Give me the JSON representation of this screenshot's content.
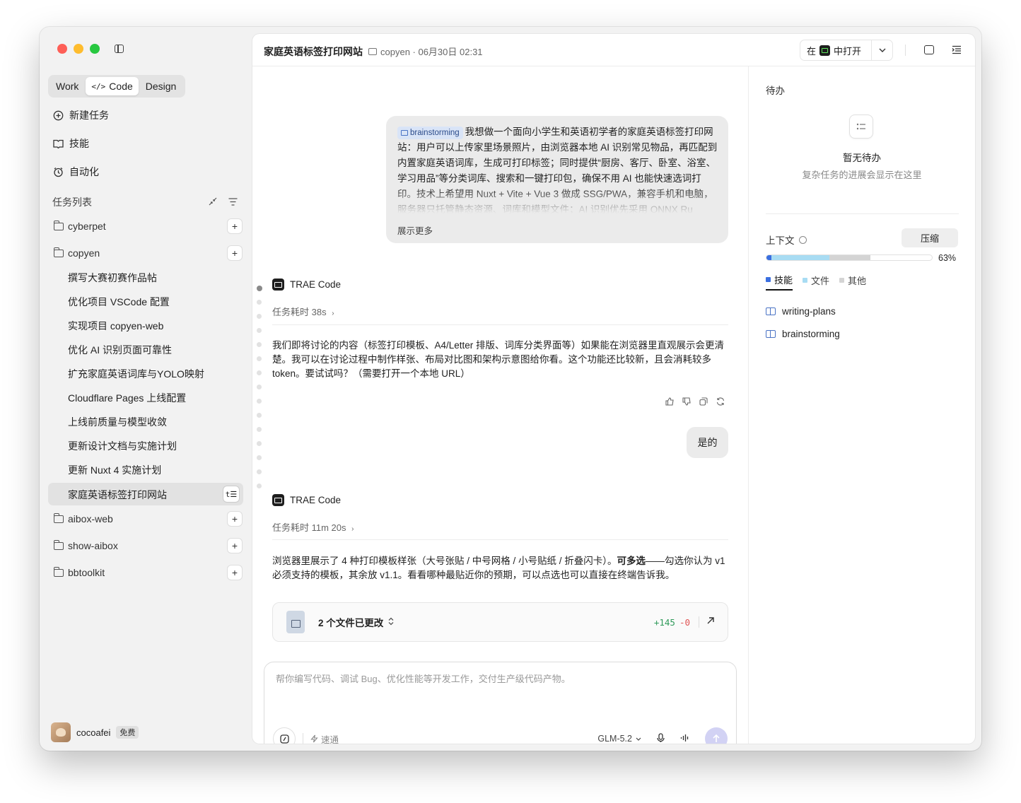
{
  "sidebar": {
    "modes": [
      "Work",
      "Code",
      "Design"
    ],
    "active_mode": "Code",
    "nav": [
      {
        "label": "新建任务",
        "icon": "new-task-icon"
      },
      {
        "label": "技能",
        "icon": "skills-icon"
      },
      {
        "label": "自动化",
        "icon": "alarm-clock-icon"
      }
    ],
    "section_title": "任务列表",
    "projects_top": [
      "cyberpet",
      "copyen"
    ],
    "tasks": [
      "撰写大赛初赛作品帖",
      "优化项目 VSCode 配置",
      "实现项目 copyen-web",
      "优化 AI 识别页面可靠性",
      "扩充家庭英语词库与YOLO映射",
      "Cloudflare Pages 上线配置",
      "上线前质量与模型收敛",
      "更新设计文档与实施计划",
      "更新 Nuxt 4 实施计划"
    ],
    "active_task": "家庭英语标签打印网站",
    "projects_bottom": [
      "aibox-web",
      "show-aibox",
      "bbtoolkit"
    ],
    "user": {
      "name": "cocoafei",
      "plan": "免费"
    }
  },
  "topbar": {
    "title": "家庭英语标签打印网站",
    "meta": "copyen · 06月30日 02:31",
    "open_in_prefix": "在",
    "open_in_suffix": "中打开"
  },
  "chat": {
    "user_message": {
      "skill_tag": "brainstorming",
      "text": "我想做一个面向小学生和英语初学者的家庭英语标签打印网站：用户可以上传家里场景照片，由浏览器本地 AI 识别常见物品，再匹配到内置家庭英语词库，生成可打印标签；同时提供“厨房、客厅、卧室、浴室、学习用品”等分类词库、搜索和一键打印包，确保不用 AI 也能快速选词打印。技术上希望用 Nuxt + Vite + Vue 3 做成 SSG/PWA，兼容手机和电脑，服务器只托管静态资源、词库和模型文件；AI 识别优先采用 ONNX Ru",
      "show_more": "展示更多"
    },
    "agent_name": "TRAE Code",
    "turn1": {
      "duration": "任务耗时 38s",
      "text": "我们即将讨论的内容（标签打印模板、A4/Letter 排版、词库分类界面等）如果能在浏览器里直观展示会更清楚。我可以在讨论过程中制作样张、布局对比图和架构示意图给你看。这个功能还比较新，且会消耗较多 token。要试试吗？（需要打开一个本地 URL）"
    },
    "reply": "是的",
    "turn2": {
      "duration": "任务耗时 11m 20s",
      "text_a": "浏览器里展示了 4 种打印模板样张（大号张贴 / 中号网格 / 小号贴纸 / 折叠闪卡）。",
      "text_bold": "可多选",
      "text_b": "——勾选你认为 v1 必须支持的模板，其余放 v1.1。看看哪种最贴近你的预期，可以点选也可以直接在终端告诉我。"
    },
    "files_changed": {
      "label": "2 个文件已更改",
      "additions": "+145",
      "deletions": "-0"
    }
  },
  "composer": {
    "placeholder": "帮你编写代码、调试 Bug、优化性能等开发工作，交付生产级代码产物。",
    "speed_label": "速通",
    "model": "GLM-5.2"
  },
  "right_panel": {
    "todo_title": "待办",
    "empty_title": "暂无待办",
    "empty_sub": "复杂任务的进展会显示在这里",
    "context_title": "上下文",
    "compress_label": "压缩",
    "context_percent": "63%",
    "context_usage": {
      "skills": 0.38,
      "files": 0.25
    },
    "legend": [
      "技能",
      "文件",
      "其他"
    ],
    "colors": {
      "skills": "#3b6fe0",
      "files": "#a8dcf3",
      "other": "#d4d4d4"
    },
    "skills": [
      "writing-plans",
      "brainstorming"
    ]
  }
}
